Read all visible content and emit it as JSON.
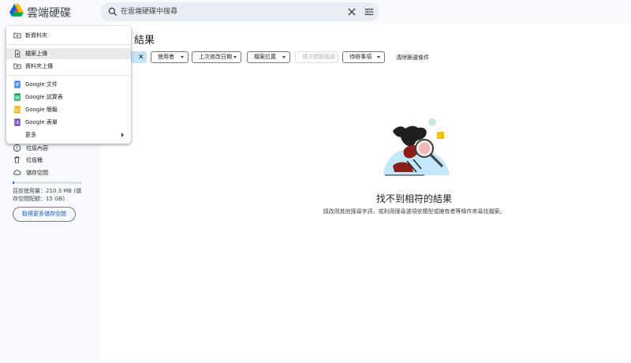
{
  "app": {
    "title": "雲端硬碟"
  },
  "search": {
    "placeholder": "在雲端硬碟中搜尋"
  },
  "results": {
    "heading": "結果",
    "empty_title": "找不到相符的結果",
    "empty_subtitle": "請改用其他搜尋字詞，或利用搜尋選項依類型或擁有者等條件來尋找檔案。"
  },
  "filters": {
    "chips": [
      "使用者",
      "上次修改日期",
      "檔案位置",
      "僅次標題搜尋",
      "待辦事項"
    ],
    "clear_label": "清除篩選條件"
  },
  "new_menu": {
    "items": [
      {
        "label": "新資料夾",
        "icon": "new-folder-icon"
      },
      {
        "label": "檔案上傳",
        "icon": "file-upload-icon"
      },
      {
        "label": "資料夾上傳",
        "icon": "folder-upload-icon"
      },
      {
        "label": "Google 文件",
        "icon": "google-docs-icon",
        "color": "#4285f4"
      },
      {
        "label": "Google 試算表",
        "icon": "google-sheets-icon",
        "color": "#0f9d58"
      },
      {
        "label": "Google 簡報",
        "icon": "google-slides-icon",
        "color": "#f4b400"
      },
      {
        "label": "Google 表單",
        "icon": "google-forms-icon",
        "color": "#7248b9"
      },
      {
        "label": "更多",
        "icon": "chevron-right-icon"
      }
    ]
  },
  "sidebar": {
    "items": [
      {
        "label": "垃圾內容",
        "icon": "spam-icon"
      },
      {
        "label": "垃圾桶",
        "icon": "trash-icon"
      },
      {
        "label": "儲存空間",
        "icon": "cloud-icon"
      }
    ],
    "storage": {
      "used_text": "目前使用量：210.3 MB (儲存空間配額：15 GB)",
      "used_fraction": 0.014,
      "button_label": "取得更多儲存空間"
    }
  },
  "colors": {
    "accent": "#0b57d0",
    "chip_active": "#c2e7ff"
  }
}
